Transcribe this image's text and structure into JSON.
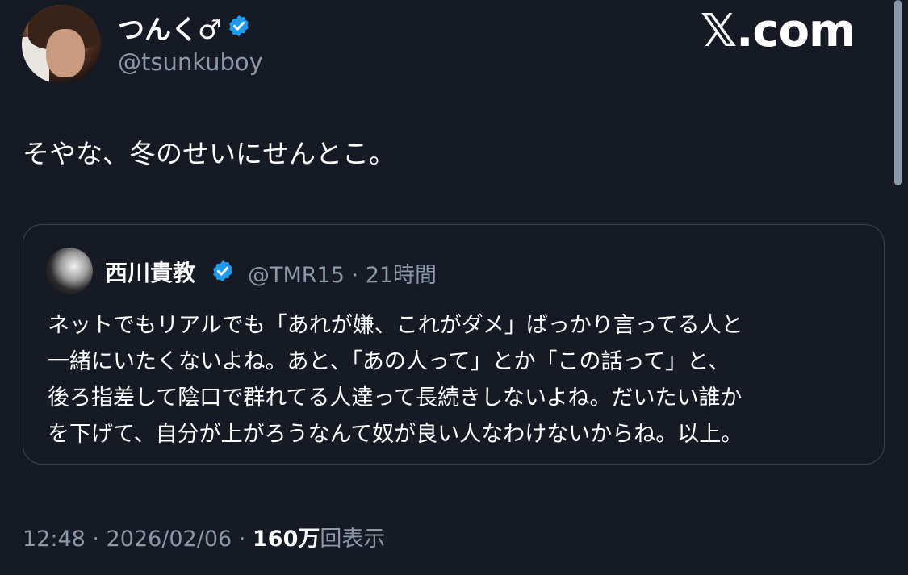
{
  "tweet": {
    "author": {
      "display_name": "つんく♂",
      "handle": "@tsunkuboy",
      "avatar_icon": "user-avatar",
      "verified": true
    },
    "brand": "𝕏.com",
    "text": "そやな、冬のせいにせんとこ。",
    "quote": {
      "display_name": "西川貴教",
      "handle": "@TMR15",
      "separator": "·",
      "time_ago": "21時間",
      "verified": true,
      "lines": [
        "ネットでもリアルでも「あれが嫌、これがダメ」ばっかり言ってる人と",
        "一緒にいたくないよね。あと、「あの人って」とか「この話って」と、",
        "後ろ指差して陰口で群れてる人達って長続きしないよね。だいたい誰か",
        "を下げて、自分が上がろうなんて奴が良い人なわけないからね。以上。"
      ]
    },
    "footer": {
      "time": "12:48",
      "sep1": "·",
      "date": "2026/02/06",
      "sep2": "·",
      "views_count": "160万",
      "views_label": "回表示"
    }
  },
  "colors": {
    "background": "#151a24",
    "verified_blue": "#1d9bf0",
    "muted_text": "#8b98a5",
    "border": "#38444d"
  }
}
